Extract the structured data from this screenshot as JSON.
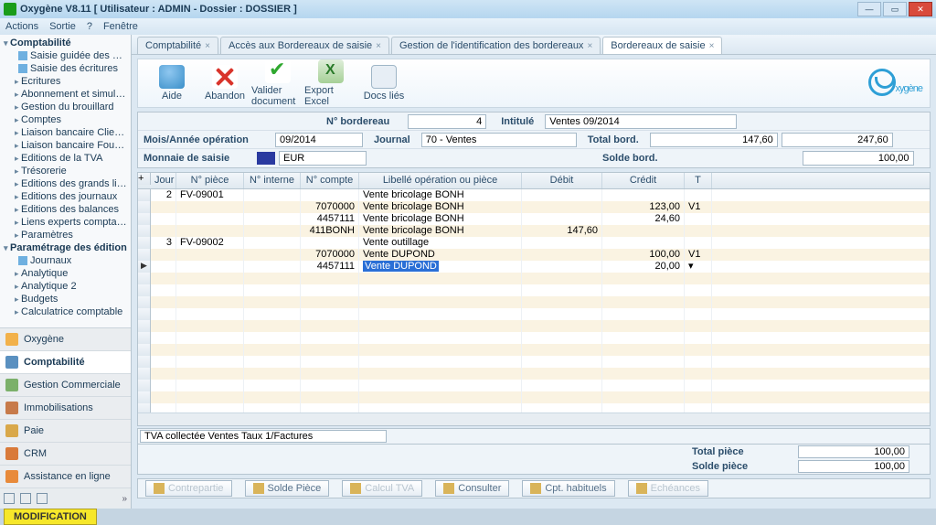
{
  "window": {
    "title": "Oxygène V8.11 [ Utilisateur : ADMIN - Dossier : DOSSIER ]"
  },
  "menu": {
    "items": [
      "Actions",
      "Sortie",
      "?",
      "Fenêtre"
    ]
  },
  "sidebar": {
    "root": "Comptabilité",
    "docs": [
      "Saisie guidée des écritu",
      "Saisie des écritures"
    ],
    "items": [
      "Ecritures",
      "Abonnement et simulatio",
      "Gestion du brouillard",
      "Comptes",
      "Liaison bancaire Clients",
      "Liaison bancaire Fournis",
      "Editions de la TVA",
      "Trésorerie",
      "Editions des grands livre",
      "Editions des journaux",
      "Editions des balances",
      "Liens experts comptable",
      "Paramètres"
    ],
    "root2": "Paramétrage des édition",
    "docs2": [
      "Journaux"
    ],
    "items2": [
      "Analytique",
      "Analytique 2",
      "Budgets",
      "Calculatrice comptable"
    ],
    "sections": [
      "Oxygène",
      "Comptabilité",
      "Gestion Commerciale",
      "Immobilisations",
      "Paie",
      "CRM",
      "Assistance en ligne"
    ]
  },
  "tabs": [
    {
      "label": "Comptabilité"
    },
    {
      "label": "Accès aux Bordereaux de saisie"
    },
    {
      "label": "Gestion de l'identification des bordereaux"
    },
    {
      "label": "Bordereaux de saisie",
      "active": true
    }
  ],
  "toolbar": {
    "aide": "Aide",
    "abandon": "Abandon",
    "valider": "Valider document",
    "export": "Export Excel",
    "docs": "Docs liés",
    "logo": "xygène"
  },
  "form": {
    "num_label": "N° bordereau",
    "num_value": "4",
    "intitule_label": "Intitulé",
    "intitule_value": "Ventes 09/2014",
    "mois_label": "Mois/Année opération",
    "mois_value": "09/2014",
    "journal_label": "Journal",
    "journal_value": "70 - Ventes",
    "total_label": "Total bord.",
    "total_debit": "147,60",
    "total_credit": "247,60",
    "monnaie_label": "Monnaie de saisie",
    "monnaie_value": "EUR",
    "solde_label": "Solde bord.",
    "solde_value": "100,00"
  },
  "grid": {
    "headers": {
      "jour": "Jour",
      "piece": "N° pièce",
      "interne": "N° interne",
      "compte": "N° compte",
      "lib": "Libellé opération ou pièce",
      "debit": "Débit",
      "credit": "Crédit",
      "t": "T"
    },
    "rows": [
      {
        "jour": "2",
        "piece": "FV-09001",
        "lib": "Vente bricolage BONH"
      },
      {
        "compte": "7070000",
        "lib": "Vente bricolage BONH",
        "credit": "123,00",
        "t": "V1"
      },
      {
        "compte": "4457111",
        "lib": "Vente bricolage BONH",
        "credit": "24,60"
      },
      {
        "compte": "411BONH",
        "lib": "Vente bricolage BONH",
        "debit": "147,60"
      },
      {
        "jour": "3",
        "piece": "FV-09002",
        "lib": "Vente outillage"
      },
      {
        "compte": "7070000",
        "lib": "Vente DUPOND",
        "credit": "100,00",
        "t": "V1"
      },
      {
        "ptr": true,
        "compte": "4457111",
        "lib": "Vente DUPOND",
        "credit": "20,00",
        "t": "▾",
        "selected": true
      }
    ],
    "footer": "TVA collectée Ventes Taux 1/Factures"
  },
  "totals": {
    "piece_label": "Total pièce",
    "piece_value": "100,00",
    "solde_label": "Solde pièce",
    "solde_value": "100,00"
  },
  "bottom": [
    {
      "label": "Contrepartie",
      "dis": true
    },
    {
      "label": "Solde Pièce"
    },
    {
      "label": "Calcul TVA",
      "dis": true
    },
    {
      "label": "Consulter"
    },
    {
      "label": "Cpt. habituels"
    },
    {
      "label": "Echéances",
      "dis": true
    }
  ],
  "status": "MODIFICATION"
}
